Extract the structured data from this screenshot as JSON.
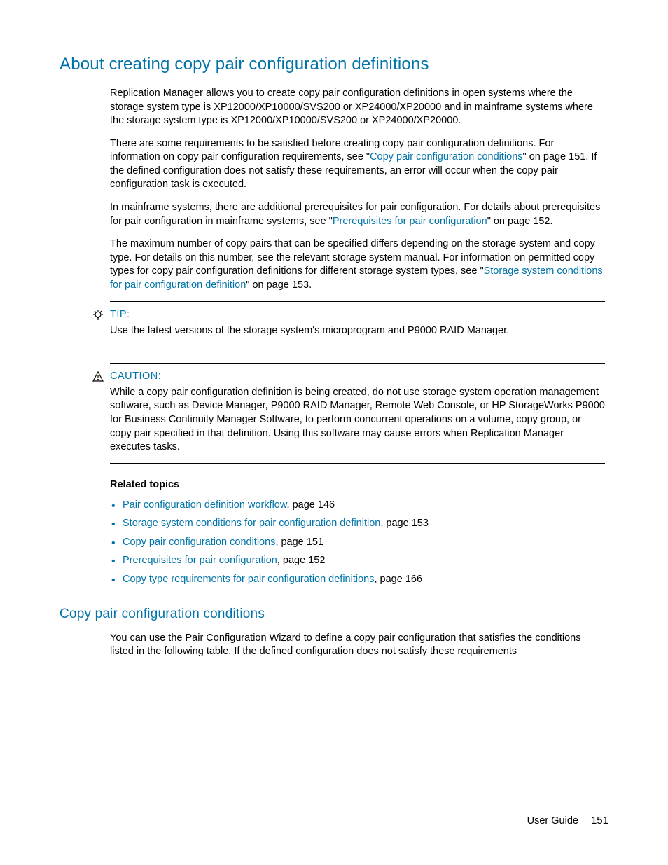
{
  "headings": {
    "main": "About creating copy pair configuration definitions",
    "sub": "Copy pair configuration conditions"
  },
  "paragraphs": {
    "p1": "Replication Manager allows you to create copy pair configuration definitions in open systems where the storage system type is XP12000/XP10000/SVS200 or XP24000/XP20000 and in mainframe systems where the storage system type is XP12000/XP10000/SVS200 or XP24000/XP20000.",
    "p2a": "There are some requirements to be satisfied before creating copy pair configuration definitions. For information on copy pair configuration requirements, see \"",
    "p2_link1": "Copy pair configuration conditions",
    "p2b": "\" on page 151. If the defined configuration does not satisfy these requirements, an error will occur when the copy pair configuration task is executed.",
    "p3a": "In mainframe systems, there are additional prerequisites for pair configuration. For details about prerequisites for pair configuration in mainframe systems, see \"",
    "p3_link1": "Prerequisites for pair configuration",
    "p3b": "\" on page 152.",
    "p4a": "The maximum number of copy pairs that can be specified differs depending on the storage system and copy type. For details on this number, see the relevant storage system manual. For information on permitted copy types for copy pair configuration definitions for different storage system types, see \"",
    "p4_link1": "Storage system conditions for pair configuration definition",
    "p4b": "\" on page 153.",
    "sub_p1": "You can use the Pair Configuration Wizard to define a copy pair configuration that satisfies the conditions listed in the following table. If the defined configuration does not satisfy these requirements"
  },
  "tip": {
    "label": "TIP:",
    "body": "Use the latest versions of the storage system's microprogram and P9000 RAID Manager."
  },
  "caution": {
    "label": "CAUTION:",
    "body": "While a copy pair configuration definition is being created, do not use storage system operation management software, such as Device Manager, P9000 RAID Manager, Remote Web Console, or HP StorageWorks P9000 for Business Continuity Manager Software, to perform concurrent operations on a volume, copy group, or copy pair specified in that definition. Using this software may cause errors when Replication Manager executes tasks."
  },
  "related": {
    "heading": "Related topics",
    "items": [
      {
        "link": "Pair configuration definition workflow",
        "suffix": ", page 146"
      },
      {
        "link": "Storage system conditions for pair configuration definition",
        "suffix": ", page 153"
      },
      {
        "link": "Copy pair configuration conditions",
        "suffix": ", page 151"
      },
      {
        "link": "Prerequisites for pair configuration",
        "suffix": ", page 152"
      },
      {
        "link": "Copy type requirements for pair configuration definitions",
        "suffix": ", page 166"
      }
    ]
  },
  "footer": {
    "label": "User Guide",
    "page": "151"
  }
}
